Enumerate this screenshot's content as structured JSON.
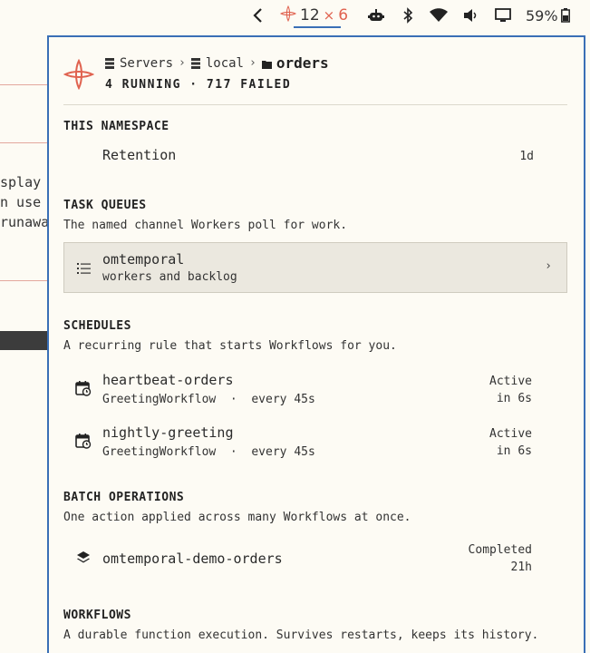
{
  "topbar": {
    "running_count": "12",
    "failed_separator": "×",
    "failed_count": "6",
    "battery": "59%"
  },
  "background_window": {
    "lines": [
      "splay",
      "n use",
      "runawa"
    ]
  },
  "panel": {
    "breadcrumb": {
      "servers": "Servers",
      "sep1": "›",
      "local": "local",
      "sep2": "›",
      "current": "orders"
    },
    "summary": "4 RUNNING · 717 FAILED",
    "namespace": {
      "title": "THIS NAMESPACE",
      "retention_label": "Retention",
      "retention_value": "1d"
    },
    "task_queues": {
      "title": "TASK QUEUES",
      "description": "The named channel Workers poll for work.",
      "items": [
        {
          "name": "omtemporal",
          "subtitle": "workers and backlog",
          "chevron": "›"
        }
      ]
    },
    "schedules": {
      "title": "SCHEDULES",
      "description": "A recurring rule that starts Workflows for you.",
      "items": [
        {
          "name": "heartbeat-orders",
          "subtitle": "GreetingWorkflow  ·  every 45s",
          "status": "Active",
          "next": "in 6s"
        },
        {
          "name": "nightly-greeting",
          "subtitle": "GreetingWorkflow  ·  every 45s",
          "status": "Active",
          "next": "in 6s"
        }
      ]
    },
    "batch_operations": {
      "title": "BATCH OPERATIONS",
      "description": "One action applied across many Workflows at once.",
      "items": [
        {
          "name": "omtemporal-demo-orders",
          "status": "Completed",
          "age": "21h"
        }
      ]
    },
    "workflows": {
      "title": "WORKFLOWS",
      "description": "A durable function execution. Survives restarts, keeps its history."
    }
  },
  "colors": {
    "accent_blue": "#3a6fb6",
    "failed_red": "#e0624f",
    "background": "#fdfbf4"
  }
}
